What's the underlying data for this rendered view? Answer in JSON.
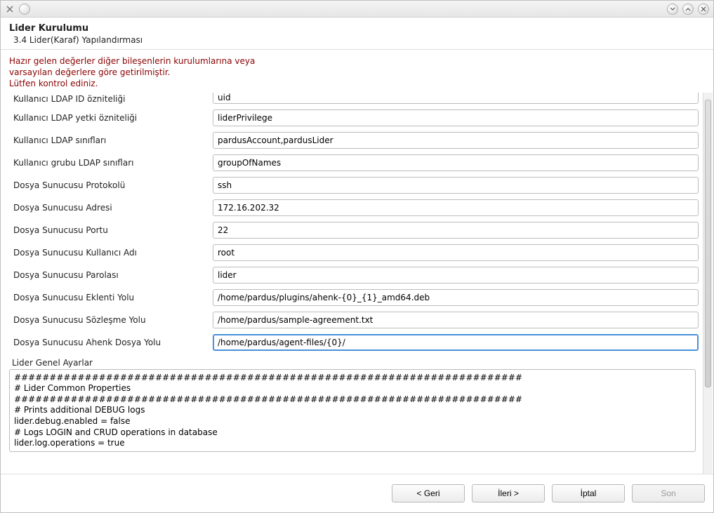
{
  "titlebar": {
    "app_icon": "app-icon",
    "minimize_tip": "Minimize",
    "maximize_tip": "Maximize",
    "close_tip": "Close"
  },
  "header": {
    "title": "Lider Kurulumu",
    "subtitle": "3.4 Lider(Karaf) Yapılandırması"
  },
  "warning": {
    "line1": "Hazır gelen değerler diğer bileşenlerin kurulumlarına veya",
    "line2": "varsayılan değerlere göre getirilmiştir.",
    "line3": "Lütfen kontrol ediniz."
  },
  "form": {
    "rows": [
      {
        "label": "Kullanıcı LDAP ID özniteliği",
        "value": "uid",
        "clipped": true
      },
      {
        "label": "Kullanıcı LDAP yetki özniteliği",
        "value": "liderPrivilege"
      },
      {
        "label": "Kullanıcı LDAP sınıfları",
        "value": "pardusAccount,pardusLider"
      },
      {
        "label": "Kullanıcı grubu LDAP sınıfları",
        "value": "groupOfNames"
      },
      {
        "label": "Dosya Sunucusu Protokolü",
        "value": "ssh"
      },
      {
        "label": "Dosya Sunucusu Adresi",
        "value": "172.16.202.32"
      },
      {
        "label": "Dosya Sunucusu Portu",
        "value": "22"
      },
      {
        "label": "Dosya Sunucusu Kullanıcı Adı",
        "value": "root"
      },
      {
        "label": "Dosya Sunucusu Parolası",
        "value": "lider"
      },
      {
        "label": "Dosya Sunucusu Eklenti Yolu",
        "value": "/home/pardus/plugins/ahenk-{0}_{1}_amd64.deb"
      },
      {
        "label": "Dosya Sunucusu Sözleşme Yolu",
        "value": "/home/pardus/sample-agreement.txt"
      },
      {
        "label": "Dosya Sunucusu Ahenk Dosya Yolu",
        "value": "/home/pardus/agent-files/{0}/",
        "focused": true
      }
    ]
  },
  "general_settings": {
    "section_label": "Lider Genel Ayarlar",
    "text": "########################################################################\n# Lider Common Properties\n########################################################################\n# Prints additional DEBUG logs\nlider.debug.enabled = false\n# Logs LOGIN and CRUD operations in database\nlider.log.operations = true"
  },
  "footer": {
    "back": "< Geri",
    "next": "İleri >",
    "cancel": "İptal",
    "finish": "Son",
    "finish_disabled": true
  }
}
